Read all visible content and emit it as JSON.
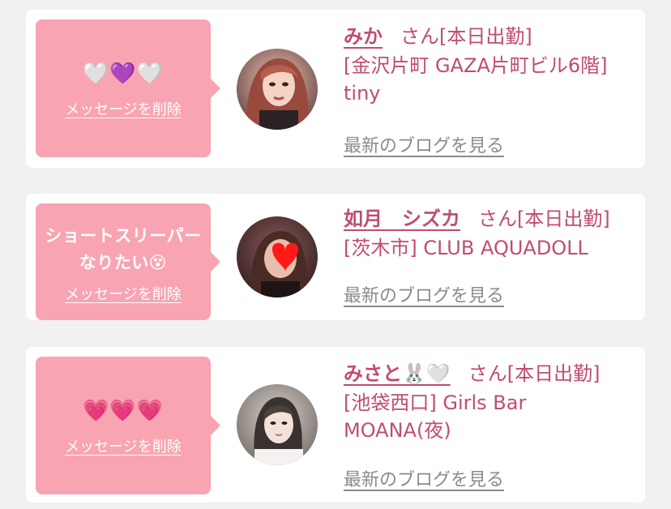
{
  "common": {
    "delete_label": "メッセージを削除",
    "blog_label": "最新のブログを見る",
    "san_text": "さん[本日出勤]"
  },
  "colors": {
    "bubble": "#f8a4b2",
    "name_text": "#c04c73",
    "link_gray": "#8b8b8b",
    "background": "#f1f1f3"
  },
  "cards": [
    {
      "message": "🤍💜🤍",
      "name": "みか",
      "shop": "[金沢片町 GAZA片町ビル6階] tiny",
      "avatar_icon": "woman-photo-avatar"
    },
    {
      "message": "ショートスリーパーなりたい😵",
      "name": "如月　シズカ",
      "shop": "[茨木市] CLUB AQUADOLL",
      "avatar_icon": "woman-photo-avatar-heart-sticker"
    },
    {
      "message": "💗💗💗",
      "name": "みさと🐰🤍",
      "shop": "[池袋西口] Girls Bar MOANA(夜)",
      "avatar_icon": "woman-photo-avatar"
    }
  ]
}
